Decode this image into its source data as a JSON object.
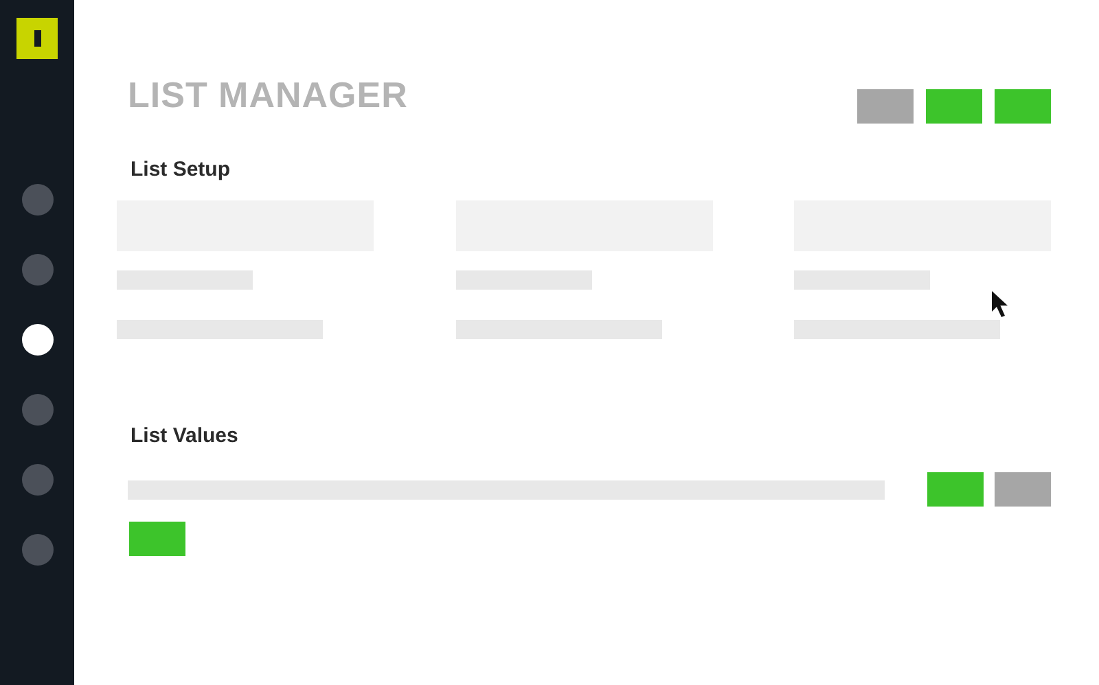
{
  "sidebar": {
    "items": [
      {
        "selected": false
      },
      {
        "selected": false
      },
      {
        "selected": true
      },
      {
        "selected": false
      },
      {
        "selected": false
      },
      {
        "selected": false
      }
    ]
  },
  "title": "LIST MANAGER",
  "header_buttons": [
    {
      "kind": "secondary"
    },
    {
      "kind": "primary"
    },
    {
      "kind": "primary"
    }
  ],
  "sections": [
    {
      "title": "List Setup"
    },
    {
      "title": "List Values"
    }
  ],
  "value_buttons": [
    {
      "kind": "primary"
    },
    {
      "kind": "secondary"
    }
  ],
  "add_button": {
    "kind": "primary"
  }
}
